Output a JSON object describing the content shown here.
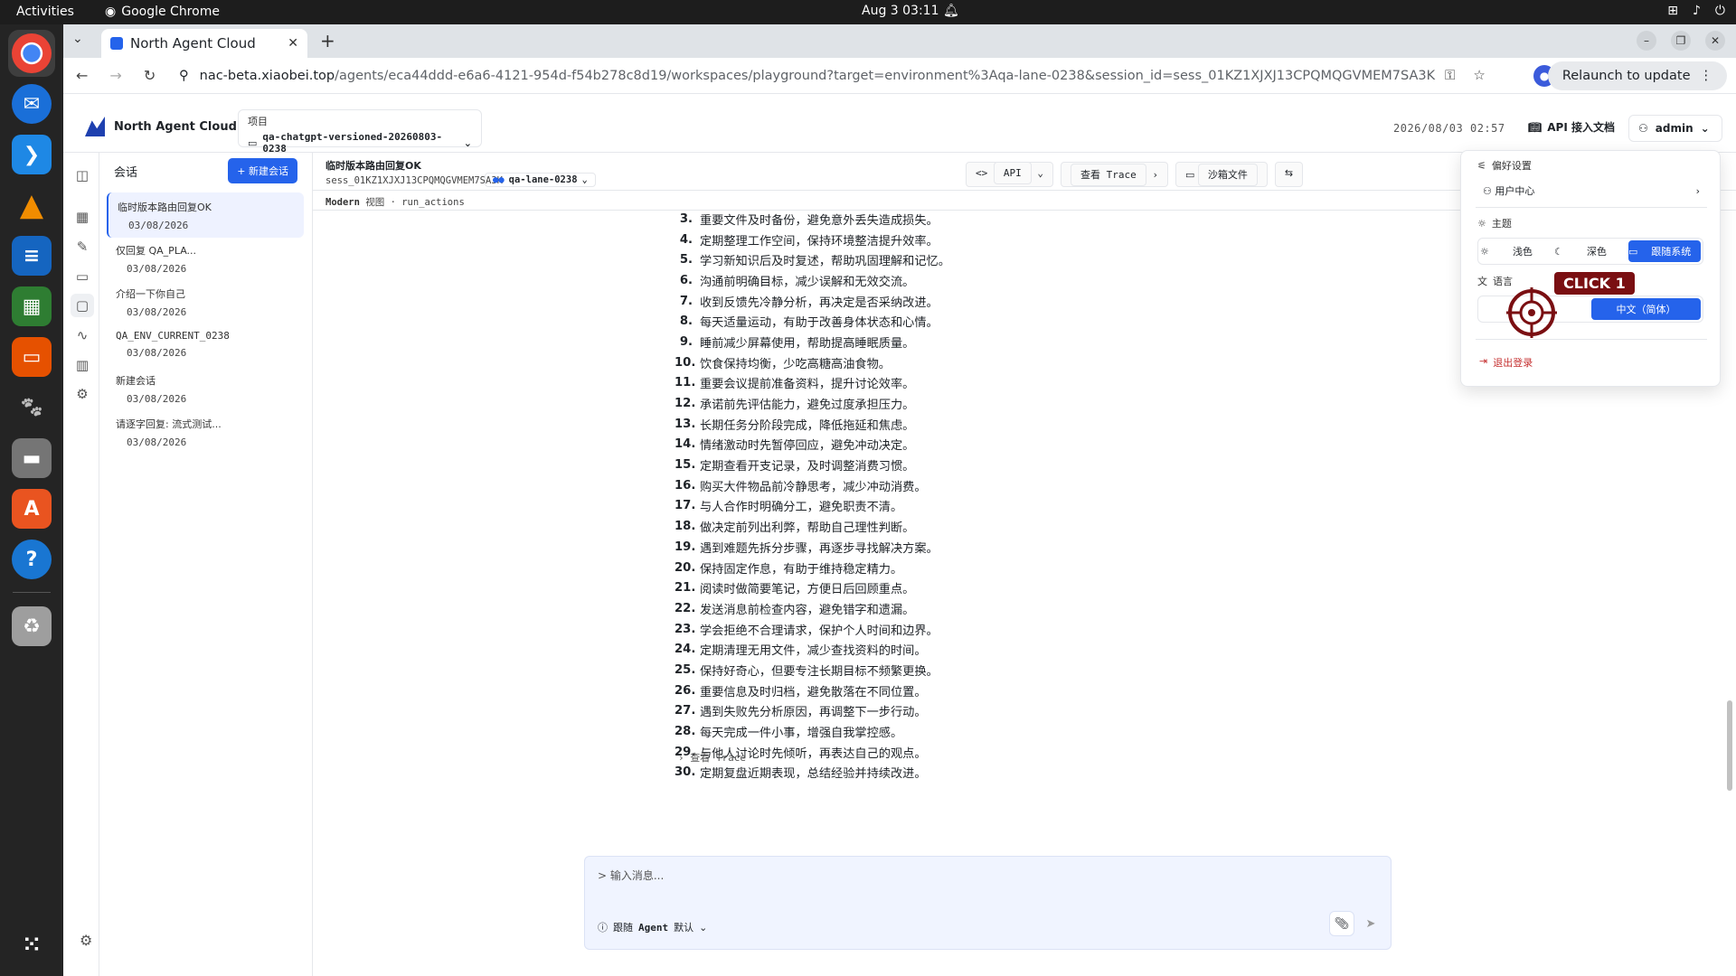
{
  "system": {
    "activities": "Activities",
    "app_name": "Google Chrome",
    "clock": "Aug 3  03:11"
  },
  "browser": {
    "tab_title": "North Agent Cloud",
    "url_host": "nac-beta.xiaobei.top",
    "url_path": "/agents/eca44ddd-e6a6-4121-954d-f54b278c8d19/workspaces/playground?target=environment%3Aqa-lane-0238&session_id=sess_01KZ1XJXJ13CPQMQGVMEM7SA3K",
    "relaunch_label": "Relaunch to update"
  },
  "header": {
    "brand": "North Agent Cloud",
    "project_label": "项目",
    "project_value": "qa-chatgpt-versioned-20260803-0238",
    "timestamp": "2026/08/03 02:57",
    "api_doc": "API 接入文档",
    "user": "admin"
  },
  "sessions": {
    "title": "会话",
    "new_button": "+ 新建会话",
    "items": [
      {
        "title": "临时版本路由回复OK",
        "date": "03/08/2026"
      },
      {
        "title": "仅回复 QA_PLA...",
        "date": "03/08/2026"
      },
      {
        "title": "介绍一下你自己",
        "date": "03/08/2026"
      },
      {
        "title": "QA_ENV_CURRENT_0238",
        "date": "03/08/2026"
      },
      {
        "title": "新建会话",
        "date": "03/08/2026"
      },
      {
        "title": "请逐字回复: 流式测试...",
        "date": "03/08/2026"
      }
    ]
  },
  "main": {
    "session_name": "临时版本路由回复OK",
    "session_id": "sess_01KZ1XJXJ13CPQMQGVMEM7SA3K",
    "lane": "qa-lane-0238",
    "btn_api": "API",
    "btn_trace": "查看 Trace",
    "btn_sandbox": "沙箱文件",
    "view_mode": "Modern",
    "view_suffix": "视图 · run_actions",
    "trace_link": "查看 Trace"
  },
  "message_lines": [
    {
      "n": "3.",
      "text": "重要文件及时备份，避免意外丢失造成损失。"
    },
    {
      "n": "4.",
      "text": "定期整理工作空间，保持环境整洁提升效率。"
    },
    {
      "n": "5.",
      "text": "学习新知识后及时复述，帮助巩固理解和记忆。"
    },
    {
      "n": "6.",
      "text": "沟通前明确目标，减少误解和无效交流。"
    },
    {
      "n": "7.",
      "text": "收到反馈先冷静分析，再决定是否采纳改进。"
    },
    {
      "n": "8.",
      "text": "每天适量运动，有助于改善身体状态和心情。"
    },
    {
      "n": "9.",
      "text": "睡前减少屏幕使用，帮助提高睡眠质量。"
    },
    {
      "n": "10.",
      "text": "饮食保持均衡，少吃高糖高油食物。"
    },
    {
      "n": "11.",
      "text": "重要会议提前准备资料，提升讨论效率。"
    },
    {
      "n": "12.",
      "text": "承诺前先评估能力，避免过度承担压力。"
    },
    {
      "n": "13.",
      "text": "长期任务分阶段完成，降低拖延和焦虑。"
    },
    {
      "n": "14.",
      "text": "情绪激动时先暂停回应，避免冲动决定。"
    },
    {
      "n": "15.",
      "text": "定期查看开支记录，及时调整消费习惯。"
    },
    {
      "n": "16.",
      "text": "购买大件物品前冷静思考，减少冲动消费。"
    },
    {
      "n": "17.",
      "text": "与人合作时明确分工，避免职责不清。"
    },
    {
      "n": "18.",
      "text": "做决定前列出利弊，帮助自己理性判断。"
    },
    {
      "n": "19.",
      "text": "遇到难题先拆分步骤，再逐步寻找解决方案。"
    },
    {
      "n": "20.",
      "text": "保持固定作息，有助于维持稳定精力。"
    },
    {
      "n": "21.",
      "text": "阅读时做简要笔记，方便日后回顾重点。"
    },
    {
      "n": "22.",
      "text": "发送消息前检查内容，避免错字和遗漏。"
    },
    {
      "n": "23.",
      "text": "学会拒绝不合理请求，保护个人时间和边界。"
    },
    {
      "n": "24.",
      "text": "定期清理无用文件，减少查找资料的时间。"
    },
    {
      "n": "25.",
      "text": "保持好奇心，但要专注长期目标不频繁更换。"
    },
    {
      "n": "26.",
      "text": "重要信息及时归档，避免散落在不同位置。"
    },
    {
      "n": "27.",
      "text": "遇到失败先分析原因，再调整下一步行动。"
    },
    {
      "n": "28.",
      "text": "每天完成一件小事，增强自我掌控感。"
    },
    {
      "n": "29.",
      "text": "与他人讨论时先倾听，再表达自己的观点。"
    },
    {
      "n": "30.",
      "text": "定期复盘近期表现，总结经验并持续改进。"
    }
  ],
  "composer": {
    "placeholder": "> 输入消息...",
    "agent_label": "跟随",
    "agent_name": "Agent",
    "agent_default": "默认"
  },
  "prefs": {
    "title": "偏好设置",
    "user_center": "用户中心",
    "theme_label": "主题",
    "theme_light": "浅色",
    "theme_dark": "深色",
    "theme_system": "跟随系统",
    "lang_label": "语言",
    "lang_other": "",
    "lang_zh": "中文（简体）",
    "logout": "退出登录"
  },
  "overlay": {
    "click_label": "CLICK 1"
  },
  "colors": {
    "accent": "#2563eb",
    "click_marker": "#7a0f12"
  }
}
